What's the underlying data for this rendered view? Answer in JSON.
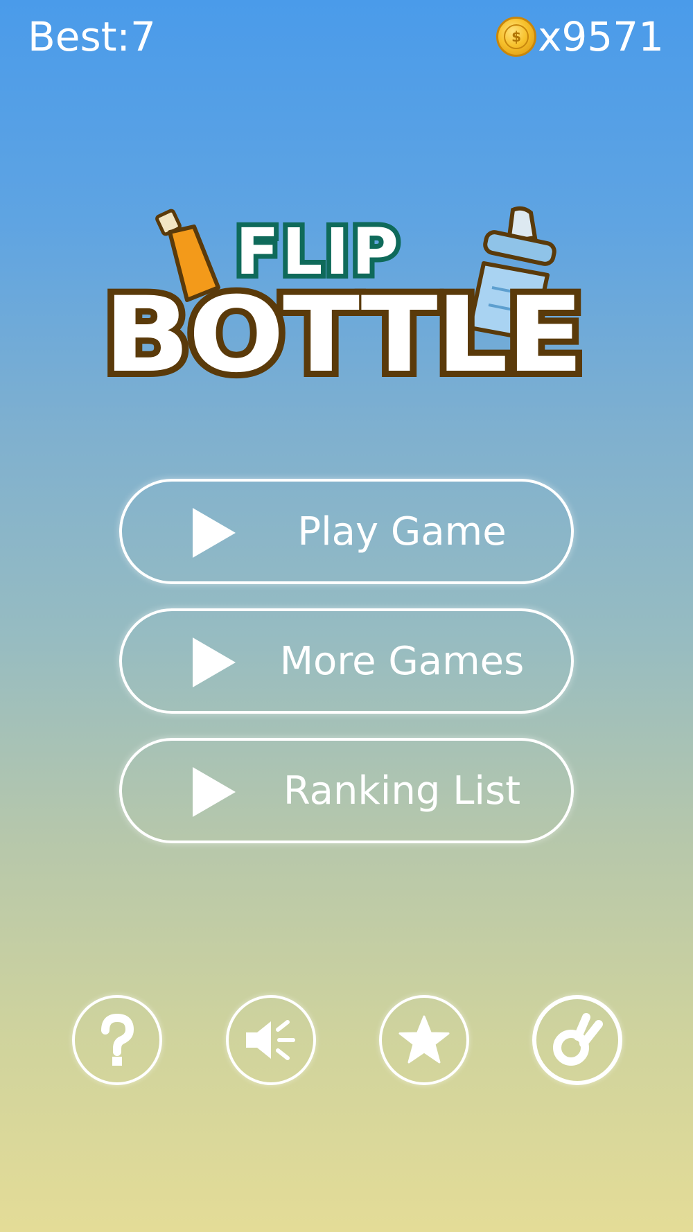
{
  "hud": {
    "best_label": "Best:7",
    "coin_symbol": "$",
    "coin_count": "x9571"
  },
  "logo": {
    "line1": "FLIP",
    "line2": "BOTTLE"
  },
  "menu": {
    "play": "Play Game",
    "more": "More Games",
    "ranking": "Ranking List"
  },
  "bottom_icons": [
    "question-icon",
    "speaker-icon",
    "star-icon",
    "brand-icon"
  ],
  "colors": {
    "sky_top": "#4a9bea",
    "sand_bottom": "#e4dc97",
    "logo_outline": "#5a3a0a",
    "logo_teal": "#0f6a5a",
    "coin": "#f7c12c"
  }
}
